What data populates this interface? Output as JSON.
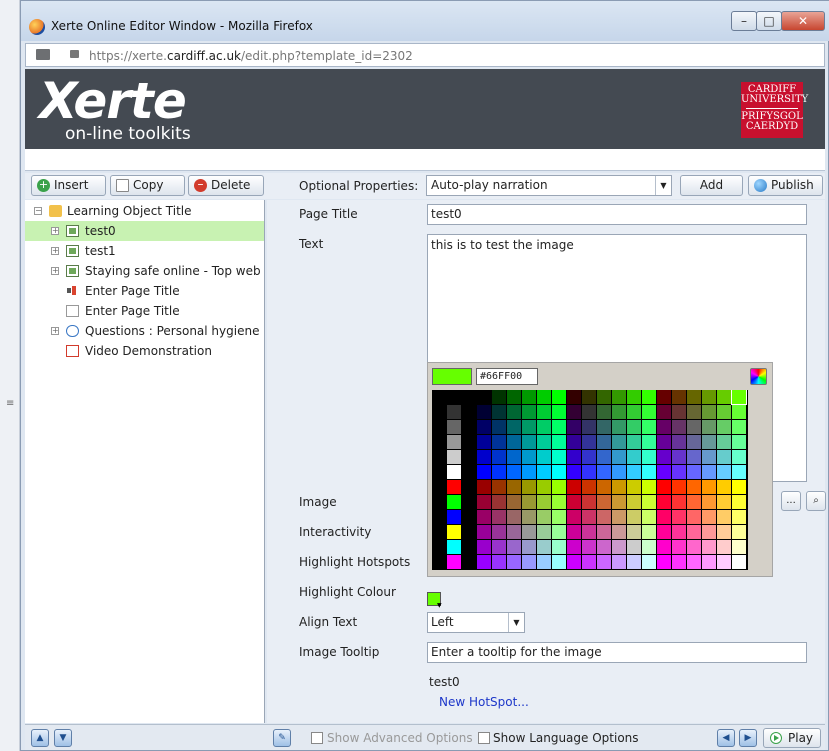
{
  "browser": {
    "window_title": "Xerte Online Editor Window - Mozilla Firefox",
    "url_prefix": "https://xerte.",
    "url_domain": "cardiff.ac.uk",
    "url_path": "/edit.php?template_id=2302",
    "controls": {
      "minimize": "–",
      "maximize": "□",
      "close": "✕"
    }
  },
  "banner": {
    "logo_main": "Xerte",
    "logo_sub": "on-line toolkits",
    "university_lines": [
      "CARDIFF",
      "UNIVERSITY",
      "PRIFYSGOL",
      "CAERDYD"
    ]
  },
  "toolbar": {
    "insert_label": "Insert",
    "copy_label": "Copy",
    "delete_label": "Delete",
    "optional_properties_label": "Optional Properties:",
    "optional_properties_value": "Auto-play narration",
    "add_label": "Add",
    "publish_label": "Publish"
  },
  "tree": {
    "root": {
      "label": "Learning Object Title",
      "icon": "folder-icon"
    },
    "items": [
      {
        "label": "test0",
        "icon": "image-page-icon",
        "selected": true,
        "expander": "+"
      },
      {
        "label": "test1",
        "icon": "image-page-icon",
        "selected": false,
        "expander": "+"
      },
      {
        "label": "Staying safe online - Top web tip",
        "icon": "image-page-icon",
        "selected": false,
        "expander": "+"
      },
      {
        "label": "Enter Page Title",
        "icon": "audio-page-icon",
        "selected": false,
        "expander": ""
      },
      {
        "label": "Enter Page Title",
        "icon": "text-page-icon",
        "selected": false,
        "expander": ""
      },
      {
        "label": "Questions : Personal hygiene",
        "icon": "quiz-icon",
        "selected": false,
        "expander": "+"
      },
      {
        "label": "Video Demonstration",
        "icon": "video-icon",
        "selected": false,
        "expander": ""
      }
    ]
  },
  "properties": {
    "page_title_label": "Page Title",
    "page_title_value": "test0",
    "text_label": "Text",
    "text_value": "this is to test the image",
    "image_label": "Image",
    "interactivity_label": "Interactivity",
    "highlight_hotspots_label": "Highlight Hotspots",
    "highlight_colour_label": "Highlight Colour",
    "highlight_colour_value": "#66ff00",
    "align_text_label": "Align Text",
    "align_text_value": "Left",
    "image_tooltip_label": "Image Tooltip",
    "image_tooltip_value": "Enter a tooltip for the image",
    "hotspot_name": "test0",
    "new_hotspot_link": "New HotSpot...",
    "browse_label": "..."
  },
  "color_picker": {
    "current_hex": "#66FF00",
    "current_color": "#66ff00"
  },
  "bottom": {
    "show_advanced_label": "Show Advanced Options",
    "show_advanced_checked": false,
    "show_language_label": "Show Language Options",
    "show_language_checked": false,
    "play_label": "Play"
  },
  "colors": {
    "banner_bg": "#444a52",
    "selection_bg": "#c8f2b2",
    "panel_bg": "#e9eef5",
    "link": "#1d37c9",
    "university_red": "#c8102e"
  }
}
